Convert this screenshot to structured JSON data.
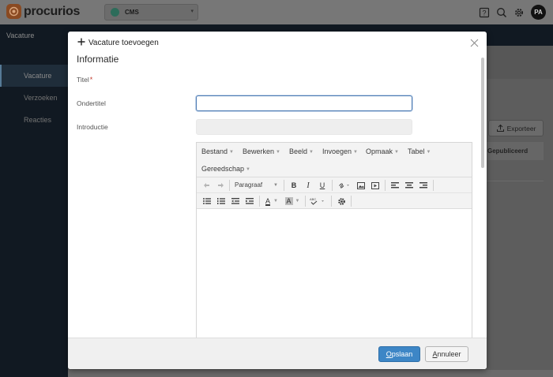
{
  "app": {
    "brand": "procurios",
    "switcher_label": "CMS",
    "avatar_initials": "PA"
  },
  "subbar": {
    "title": "Vacature"
  },
  "sidebar": {
    "items": [
      {
        "label": "Vacature",
        "active": true
      },
      {
        "label": "Verzoeken",
        "active": false
      },
      {
        "label": "Reacties",
        "active": false
      }
    ]
  },
  "background": {
    "export_label": "Exporteer",
    "status_label": "Gepubliceerd"
  },
  "modal": {
    "title": "Vacature toevoegen",
    "section_title": "Informatie",
    "fields": {
      "title_label": "Titel",
      "title_value": "",
      "required_mark": "*",
      "subtitle_label": "Ondertitel",
      "subtitle_value": "",
      "intro_label": "Introductie"
    },
    "editor": {
      "menus": [
        "Bestand",
        "Bewerken",
        "Beeld",
        "Invoegen",
        "Opmaak",
        "Tabel",
        "Gereedschap"
      ],
      "paragraph_select": "Paragraaf",
      "bold": "B",
      "italic": "I",
      "underline": "U",
      "font_color": "A",
      "bg_color": "A"
    },
    "footer": {
      "save_label": "Opslaan",
      "cancel_label": "Annuleer"
    }
  },
  "colors": {
    "accent": "#3d86c6",
    "focus_border": "#4b7ab3",
    "required": "#c0392b"
  }
}
